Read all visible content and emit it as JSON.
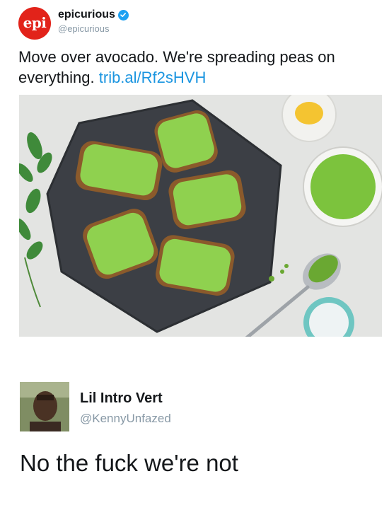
{
  "tweet": {
    "avatar_text": "epi",
    "display_name": "epicurious",
    "handle": "@epicurious",
    "text": "Move over avocado. We're spreading peas on everything.",
    "link": "trib.al/Rf2sHVH"
  },
  "reply": {
    "display_name": "Lil Intro Vert",
    "handle": "@KennyUnfazed",
    "text": "No the fuck we're not"
  },
  "colors": {
    "brand_red": "#e2231a",
    "link_blue": "#1b95e0",
    "verified_blue": "#1da1f2",
    "handle_gray": "#8899a6"
  },
  "icons": {
    "verified": "verified-badge-icon"
  }
}
